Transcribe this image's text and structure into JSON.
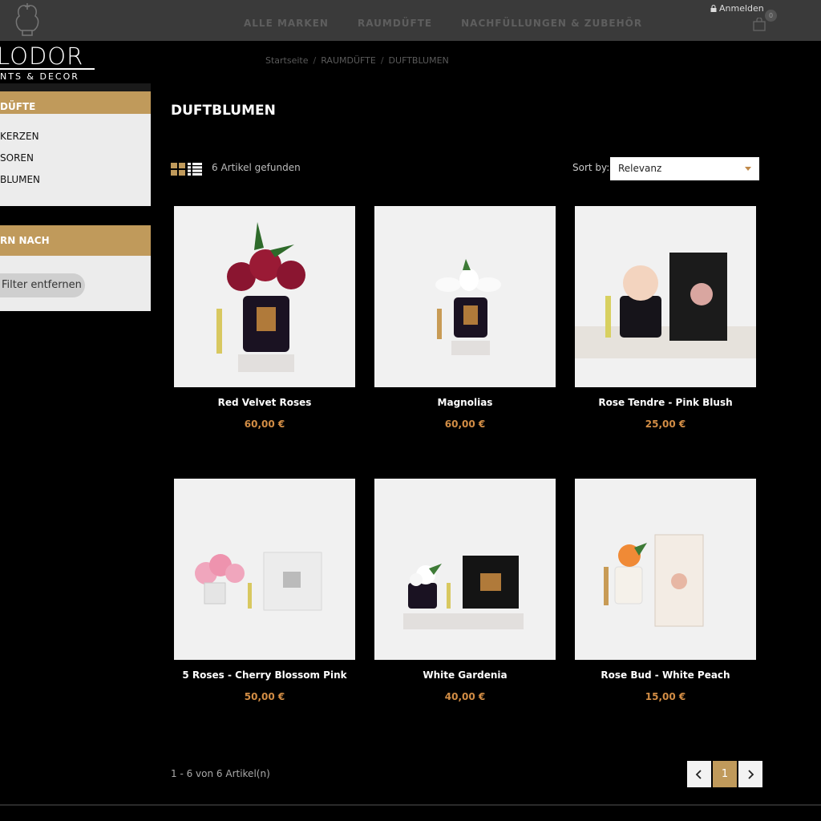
{
  "header": {
    "nav": [
      "ALLE MARKEN",
      "RAUMDÜFTE",
      "NACHFÜLLUNGEN & ZUBEHÖR"
    ],
    "login_label": "Anmelden",
    "cart_count": "0"
  },
  "brand": {
    "name": "LODOR",
    "tagline": "NTS & DECOR"
  },
  "breadcrumb": [
    "Startseite",
    "RAUMDÜFTE",
    "DUFTBLUMEN"
  ],
  "sidebar": {
    "category_title": "DÜFTE",
    "categories": [
      "KERZEN",
      "SOREN",
      "BLUMEN"
    ],
    "filter_title": "RN NACH",
    "filter_remove": "Filter entfernen"
  },
  "main": {
    "title": "DUFTBLUMEN",
    "count": "6 Artikel gefunden",
    "sort_label": "Sort by:",
    "sort_value": "Relevanz",
    "pagination_text": "1 - 6 von 6 Artikel(n)",
    "current_page": "1"
  },
  "products": [
    {
      "name": "Red Velvet Roses",
      "price": "60,00 €"
    },
    {
      "name": "Magnolias",
      "price": "60,00 €"
    },
    {
      "name": "Rose Tendre - Pink Blush",
      "price": "25,00 €"
    },
    {
      "name": "5 Roses - Cherry Blossom Pink",
      "price": "50,00 €"
    },
    {
      "name": "White Gardenia",
      "price": "40,00 €"
    },
    {
      "name": "Rose Bud - White Peach",
      "price": "15,00 €"
    }
  ],
  "colors": {
    "accent": "#c09a5b",
    "price": "#d28d45"
  }
}
